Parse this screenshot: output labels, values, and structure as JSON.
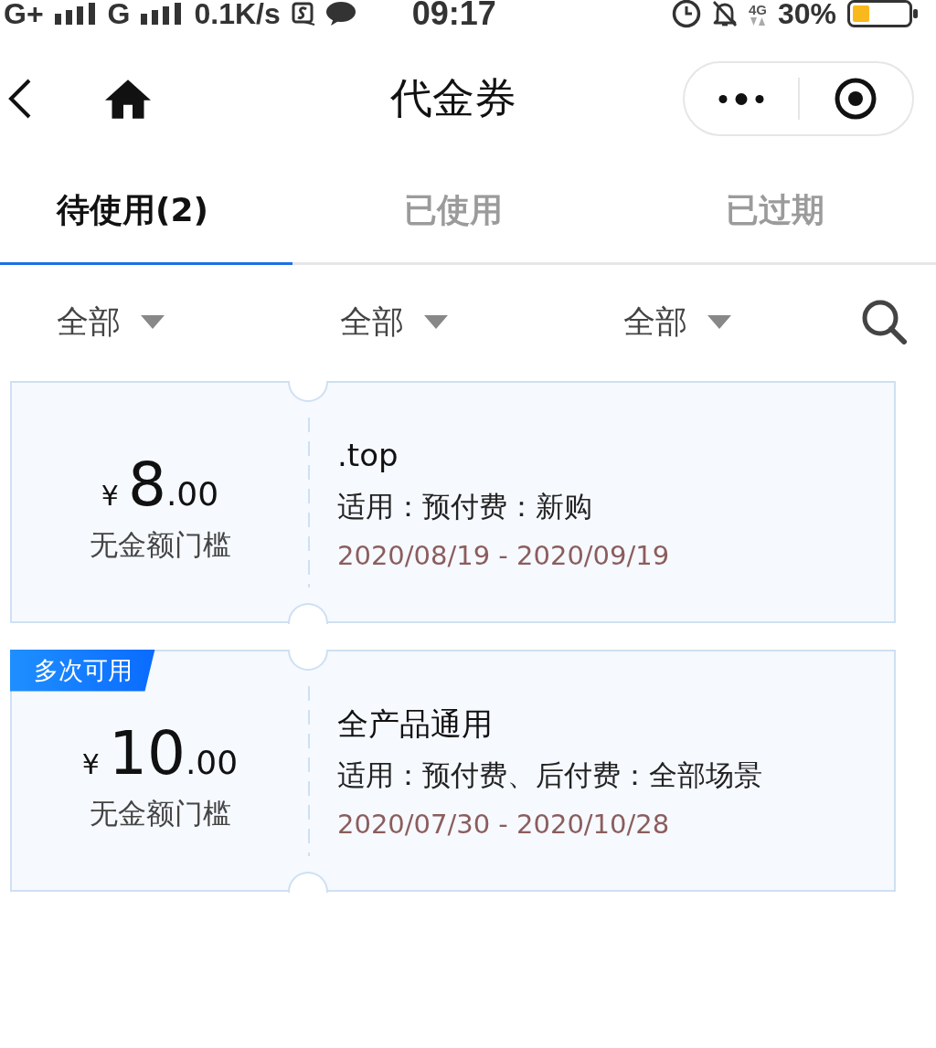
{
  "status_bar": {
    "left": [
      {
        "kind": "text",
        "text": "G+"
      },
      {
        "kind": "signal"
      },
      {
        "kind": "text",
        "text": "G"
      },
      {
        "kind": "signal"
      },
      {
        "kind": "text",
        "text": "0.1K/s"
      },
      {
        "kind": "app"
      },
      {
        "kind": "chat"
      }
    ],
    "time": "09:17",
    "right": [
      {
        "kind": "alarm"
      },
      {
        "kind": "bell-off"
      },
      {
        "kind": "network",
        "text": "4G"
      },
      {
        "kind": "text",
        "text": "30%"
      },
      {
        "kind": "battery"
      }
    ]
  },
  "nav_bar": {
    "title": "代金券"
  },
  "tabs": [
    {
      "label": "待使用(2)",
      "selected": true
    },
    {
      "label": "已使用",
      "selected": false
    },
    {
      "label": "已过期",
      "selected": false
    }
  ],
  "filters": [
    {
      "label": "全部"
    },
    {
      "label": "全部"
    },
    {
      "label": "全部"
    }
  ],
  "coupons": [
    {
      "amount": {
        "currency": "¥",
        "integer": "8",
        "decimal": ".00"
      },
      "condition": "无金额门槛",
      "title": ".top",
      "scope": "适用：预付费：新购",
      "validity": "2020/08/19 - 2020/09/19"
    },
    {
      "tag": "多次可用",
      "amount": {
        "currency": "¥",
        "integer": "10",
        "decimal": ".00"
      },
      "condition": "无金额门槛",
      "title": "全产品通用",
      "scope": "适用：预付费、后付费：全部场景",
      "validity": "2020/07/30 - 2020/10/28"
    }
  ]
}
